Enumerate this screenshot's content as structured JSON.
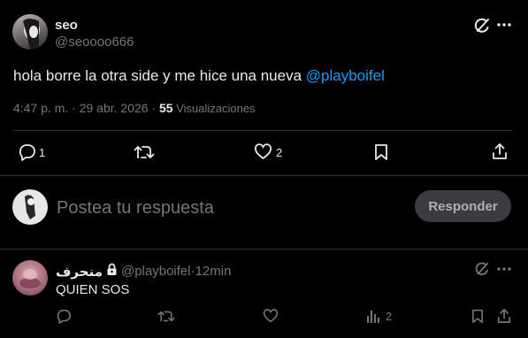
{
  "post": {
    "display_name": "seo",
    "handle": "@seoooo666",
    "text_before": "hola borre la otra side y me hice una nueva ",
    "mention": "@playboifel",
    "time": "4:47 p. m. · 29 abr. 2026 · ",
    "views_count": "55",
    "views_label": " Visualizaciones",
    "actions": {
      "reply_count": "1",
      "like_count": "2"
    }
  },
  "composer": {
    "placeholder": "Postea tu respuesta",
    "button_label": "Responder"
  },
  "reply": {
    "display_name": "منحرف",
    "handle": "@playboifel",
    "sep": " · ",
    "time": "12min",
    "text": "QUIEN SOS",
    "actions": {
      "views_count": "2"
    }
  },
  "colors": {
    "link": "#1d9bf0",
    "muted": "#71767b",
    "text": "#e7e9ea",
    "button_bg": "#3a3c3f"
  }
}
